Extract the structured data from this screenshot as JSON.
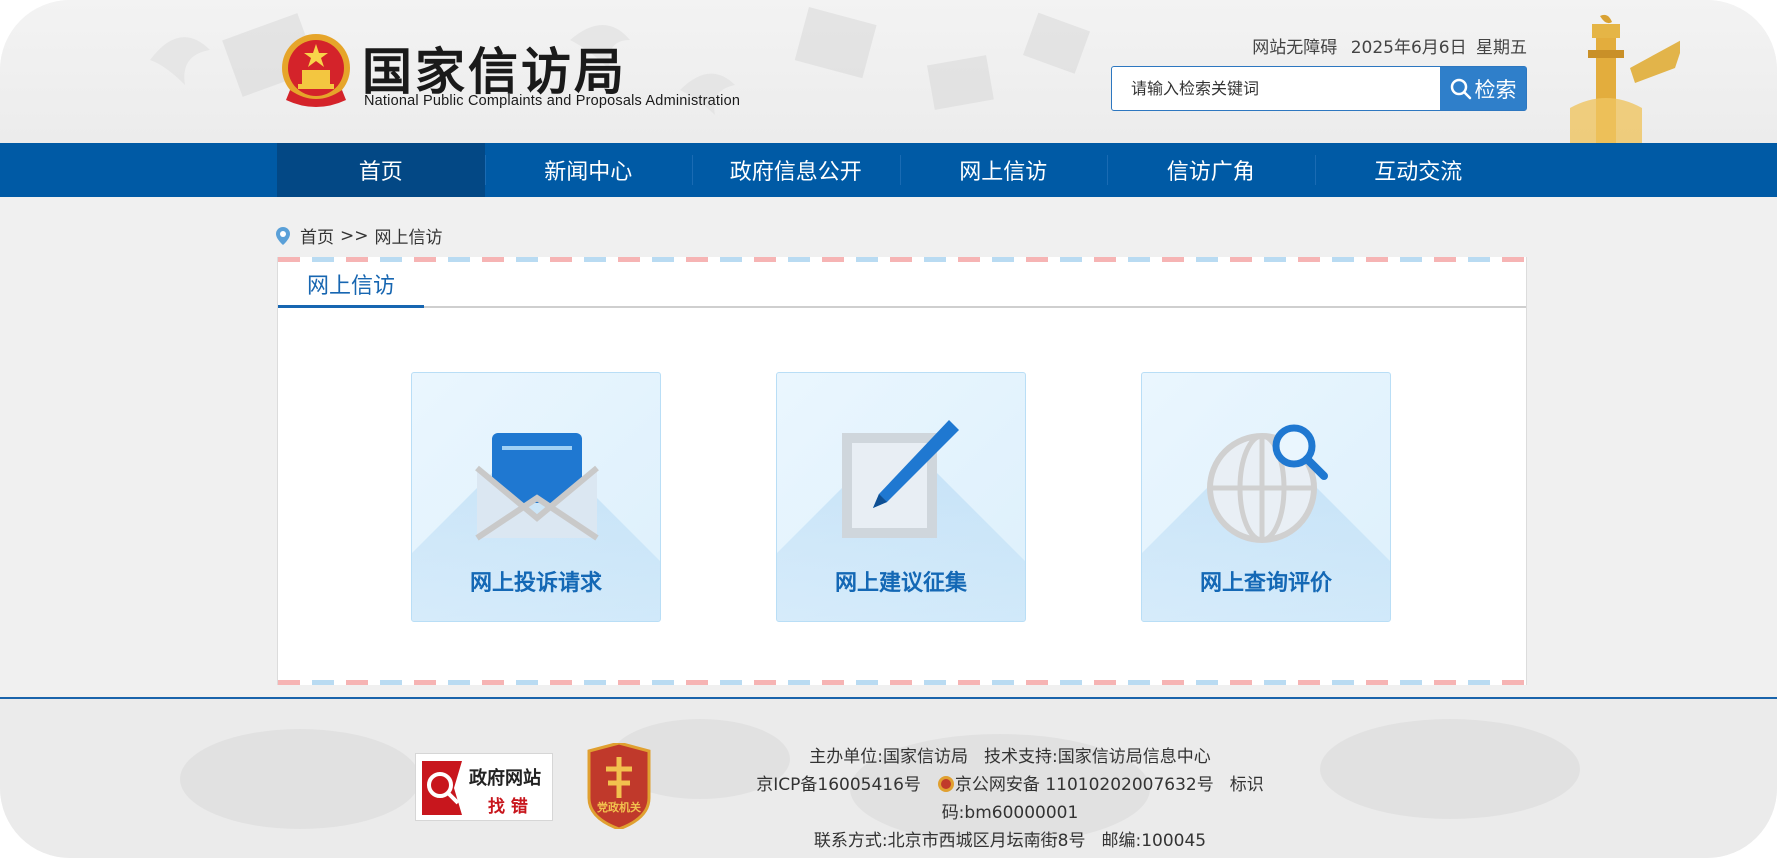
{
  "header": {
    "site_title_cn": "国家信访局",
    "site_title_en": "National Public Complaints and Proposals Administration",
    "accessibility_link": "网站无障碍",
    "date": "2025年6月6日",
    "weekday": "星期五",
    "search": {
      "placeholder": "请输入检索关键词",
      "button_label": "检索"
    }
  },
  "nav": {
    "items": [
      {
        "label": "首页",
        "active": true
      },
      {
        "label": "新闻中心",
        "active": false
      },
      {
        "label": "政府信息公开",
        "active": false
      },
      {
        "label": "网上信访",
        "active": false
      },
      {
        "label": "信访广角",
        "active": false
      },
      {
        "label": "互动交流",
        "active": false
      }
    ]
  },
  "breadcrumb": {
    "home": "首页",
    "separator": ">>",
    "current": "网上信访"
  },
  "panel": {
    "title": "网上信访",
    "cards": [
      {
        "label": "网上投诉请求",
        "icon": "envelope-icon"
      },
      {
        "label": "网上建议征集",
        "icon": "pen-note-icon"
      },
      {
        "label": "网上查询评价",
        "icon": "globe-search-icon"
      }
    ]
  },
  "footer": {
    "badge1_line1": "政府网站",
    "badge1_line2": "找 错",
    "badge2_text": "党政机关",
    "sponsor_label": "主办单位:",
    "sponsor": "国家信访局",
    "tech_label": "技术支持:",
    "tech": "国家信访局信息中心",
    "icp": "京ICP备16005416号",
    "police_record": "京公网安备 11010202007632号",
    "id_label": "标识码:",
    "id_code": "bm60000001",
    "contact_label": "联系方式:",
    "address": "北京市西城区月坛南街8号",
    "postcode_label": "邮编:",
    "postcode": "100045"
  },
  "colors": {
    "nav_bg": "#005aa5",
    "nav_active": "#034885",
    "accent_blue": "#1766b1",
    "search_button": "#2f7fca",
    "card_bg": "#e4f3fd"
  }
}
